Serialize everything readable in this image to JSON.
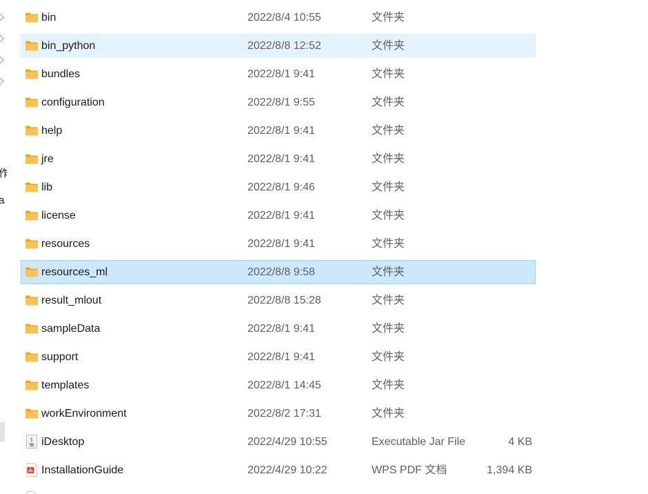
{
  "nav": {
    "fragment_1": "作",
    "fragment_2": "a"
  },
  "files": [
    {
      "name": "bin",
      "date": "2022/8/4 10:55",
      "type": "文件夹",
      "size": "",
      "icon": "folder-icon",
      "state": "normal"
    },
    {
      "name": "bin_python",
      "date": "2022/8/8 12:52",
      "type": "文件夹",
      "size": "",
      "icon": "folder-icon",
      "state": "hover"
    },
    {
      "name": "bundles",
      "date": "2022/8/1 9:41",
      "type": "文件夹",
      "size": "",
      "icon": "folder-icon",
      "state": "normal"
    },
    {
      "name": "configuration",
      "date": "2022/8/1 9:55",
      "type": "文件夹",
      "size": "",
      "icon": "folder-icon",
      "state": "normal"
    },
    {
      "name": "help",
      "date": "2022/8/1 9:41",
      "type": "文件夹",
      "size": "",
      "icon": "folder-icon",
      "state": "normal"
    },
    {
      "name": "jre",
      "date": "2022/8/1 9:41",
      "type": "文件夹",
      "size": "",
      "icon": "folder-icon",
      "state": "normal"
    },
    {
      "name": "lib",
      "date": "2022/8/1 9:46",
      "type": "文件夹",
      "size": "",
      "icon": "folder-icon",
      "state": "normal"
    },
    {
      "name": "license",
      "date": "2022/8/1 9:41",
      "type": "文件夹",
      "size": "",
      "icon": "folder-icon",
      "state": "normal"
    },
    {
      "name": "resources",
      "date": "2022/8/1 9:41",
      "type": "文件夹",
      "size": "",
      "icon": "folder-icon",
      "state": "normal"
    },
    {
      "name": "resources_ml",
      "date": "2022/8/8 9:58",
      "type": "文件夹",
      "size": "",
      "icon": "folder-icon",
      "state": "selected"
    },
    {
      "name": "result_mlout",
      "date": "2022/8/8 15:28",
      "type": "文件夹",
      "size": "",
      "icon": "folder-icon",
      "state": "normal"
    },
    {
      "name": "sampleData",
      "date": "2022/8/1 9:41",
      "type": "文件夹",
      "size": "",
      "icon": "folder-icon",
      "state": "normal"
    },
    {
      "name": "support",
      "date": "2022/8/1 9:41",
      "type": "文件夹",
      "size": "",
      "icon": "folder-icon",
      "state": "normal"
    },
    {
      "name": "templates",
      "date": "2022/8/1 14:45",
      "type": "文件夹",
      "size": "",
      "icon": "folder-icon",
      "state": "normal"
    },
    {
      "name": "workEnvironment",
      "date": "2022/8/2 17:31",
      "type": "文件夹",
      "size": "",
      "icon": "folder-icon",
      "state": "normal"
    },
    {
      "name": "iDesktop",
      "date": "2022/4/29 10:55",
      "type": "Executable Jar File",
      "size": "4 KB",
      "icon": "java-jar-icon",
      "state": "normal"
    },
    {
      "name": "InstallationGuide",
      "date": "2022/4/29 10:22",
      "type": "WPS PDF 文档",
      "size": "1,394 KB",
      "icon": "pdf-file-icon",
      "state": "normal"
    },
    {
      "name": "",
      "date": "",
      "type": "",
      "size": "",
      "icon": "file-icon",
      "state": "normal"
    }
  ],
  "colors": {
    "folder": "#f8c44f",
    "folder_dark": "#e9a824",
    "hover_bg": "#e5f3ff",
    "selected_bg": "#cce8ff",
    "selected_border": "#99d1ff"
  }
}
